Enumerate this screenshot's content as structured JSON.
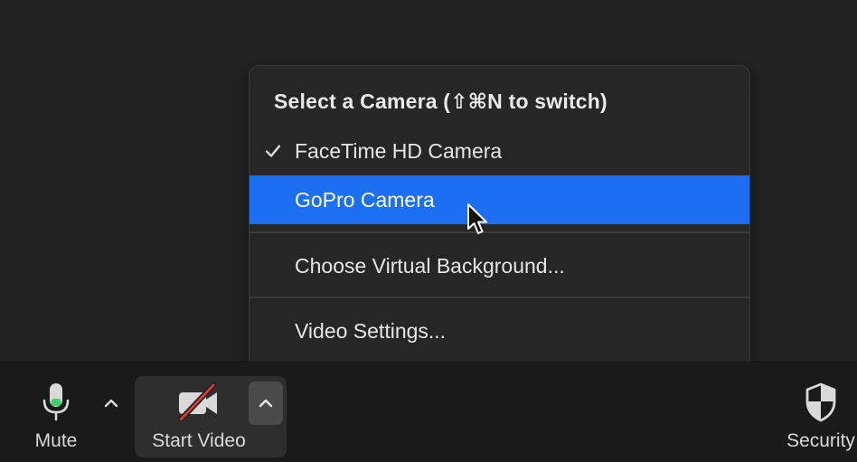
{
  "camera_menu": {
    "header": "Select a Camera (⇧⌘N to switch)",
    "items": [
      {
        "label": "FaceTime HD Camera",
        "checked": true
      },
      {
        "label": "GoPro Camera",
        "highlighted": true
      },
      {
        "label": "Choose Virtual Background..."
      },
      {
        "label": "Video Settings..."
      }
    ]
  },
  "toolbar": {
    "mute_label": "Mute",
    "start_video_label": "Start Video",
    "security_label": "Security"
  },
  "colors": {
    "highlight": "#1c6ef2",
    "mic_level": "#3fd06b",
    "video_off_slash": "#e03a3a"
  },
  "icons": {
    "mute": "microphone-icon",
    "mute_caret": "chevron-up-icon",
    "video": "video-camera-off-icon",
    "video_caret": "chevron-up-icon",
    "security": "shield-icon",
    "check": "checkmark-icon",
    "pointer": "mouse-pointer-icon"
  }
}
